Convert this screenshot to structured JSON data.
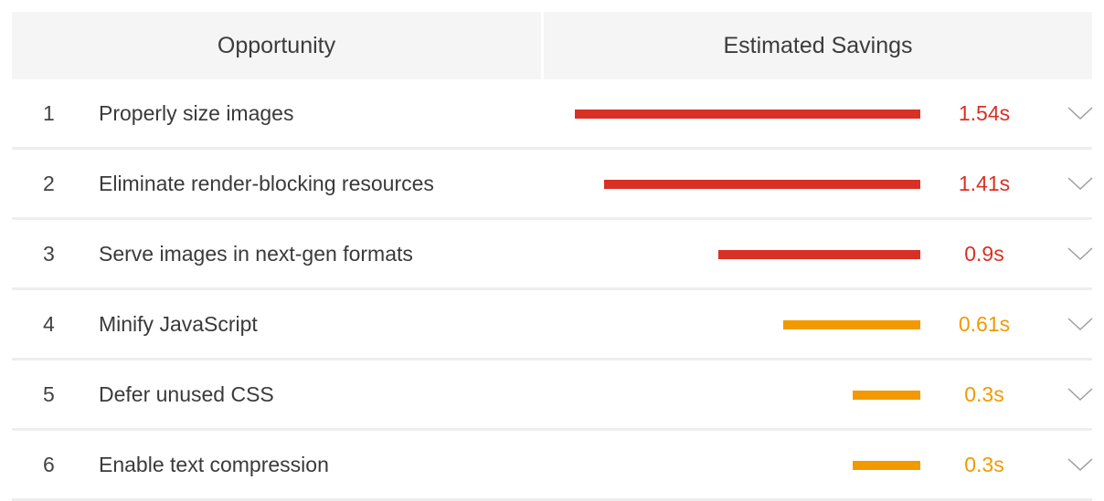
{
  "header": {
    "opportunity_label": "Opportunity",
    "savings_label": "Estimated Savings"
  },
  "colors": {
    "severe": "#d93025",
    "moderate": "#f29900",
    "chevron": "#9e9e9e"
  },
  "max_savings_s": 1.54,
  "rows": [
    {
      "index": "1",
      "title": "Properly size images",
      "savings": "1.54s",
      "savings_s": 1.54,
      "severity": "severe"
    },
    {
      "index": "2",
      "title": "Eliminate render-blocking resources",
      "savings": "1.41s",
      "savings_s": 1.41,
      "severity": "severe"
    },
    {
      "index": "3",
      "title": "Serve images in next-gen formats",
      "savings": "0.9s",
      "savings_s": 0.9,
      "severity": "severe"
    },
    {
      "index": "4",
      "title": "Minify JavaScript",
      "savings": "0.61s",
      "savings_s": 0.61,
      "severity": "moderate"
    },
    {
      "index": "5",
      "title": "Defer unused CSS",
      "savings": "0.3s",
      "savings_s": 0.3,
      "severity": "moderate"
    },
    {
      "index": "6",
      "title": "Enable text compression",
      "savings": "0.3s",
      "savings_s": 0.3,
      "severity": "moderate"
    }
  ],
  "icons": {
    "expand": "chevron-down-icon"
  }
}
